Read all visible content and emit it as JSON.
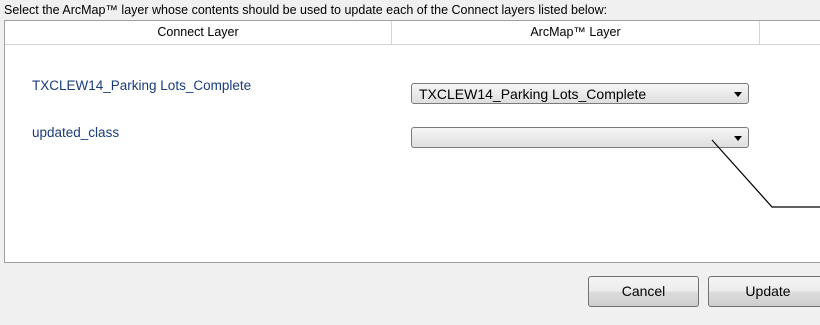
{
  "instruction": "Select the ArcMap™ layer whose contents should be used to update each of the Connect layers listed below:",
  "grid": {
    "columns": [
      "Connect Layer",
      "ArcMap™ Layer",
      ""
    ],
    "rows": [
      {
        "connect_layer": "TXCLEW14_Parking Lots_Complete",
        "arcmap_layer": "TXCLEW14_Parking Lots_Complete"
      },
      {
        "connect_layer": "updated_class",
        "arcmap_layer": ""
      }
    ]
  },
  "buttons": {
    "cancel": "Cancel",
    "update": "Update"
  },
  "icons": {
    "dropdown": "chevron-down-icon"
  }
}
